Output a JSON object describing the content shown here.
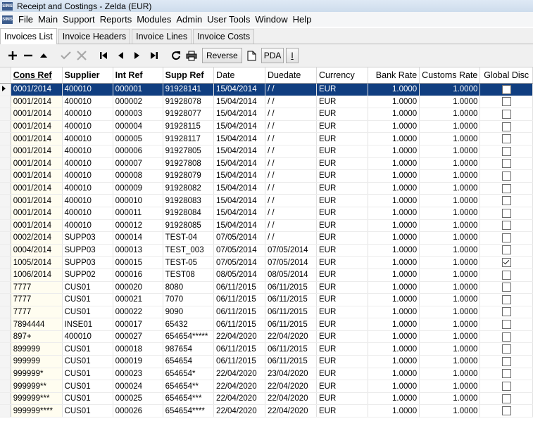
{
  "window": {
    "title": "Receipt and Costings - Zelda (EUR)",
    "app_icon_text": "SIMS"
  },
  "menu": [
    "File",
    "Main",
    "Support",
    "Reports",
    "Modules",
    "Admin",
    "User Tools",
    "Window",
    "Help"
  ],
  "tabs": [
    "Invoices List",
    "Invoice Headers",
    "Invoice Lines",
    "Invoice Costs"
  ],
  "toolbar": {
    "reverse_label": "Reverse",
    "pda_label": "PDA",
    "i_label": "I"
  },
  "columns": [
    "Cons Ref",
    "Supplier",
    "Int Ref",
    "Supp Ref",
    "Date",
    "Duedate",
    "Currency",
    "Bank Rate",
    "Customs Rate",
    "Global Disc"
  ],
  "rows": [
    [
      "0001/2014",
      "400010",
      "000001",
      "91928141",
      "15/04/2014",
      "/ /",
      "EUR",
      "1.0000",
      "1.0000",
      false
    ],
    [
      "0001/2014",
      "400010",
      "000002",
      "91928078",
      "15/04/2014",
      "/ /",
      "EUR",
      "1.0000",
      "1.0000",
      false
    ],
    [
      "0001/2014",
      "400010",
      "000003",
      "91928077",
      "15/04/2014",
      "/ /",
      "EUR",
      "1.0000",
      "1.0000",
      false
    ],
    [
      "0001/2014",
      "400010",
      "000004",
      "91928115",
      "15/04/2014",
      "/ /",
      "EUR",
      "1.0000",
      "1.0000",
      false
    ],
    [
      "0001/2014",
      "400010",
      "000005",
      "91928117",
      "15/04/2014",
      "/ /",
      "EUR",
      "1.0000",
      "1.0000",
      false
    ],
    [
      "0001/2014",
      "400010",
      "000006",
      "91927805",
      "15/04/2014",
      "/ /",
      "EUR",
      "1.0000",
      "1.0000",
      false
    ],
    [
      "0001/2014",
      "400010",
      "000007",
      "91927808",
      "15/04/2014",
      "/ /",
      "EUR",
      "1.0000",
      "1.0000",
      false
    ],
    [
      "0001/2014",
      "400010",
      "000008",
      "91928079",
      "15/04/2014",
      "/ /",
      "EUR",
      "1.0000",
      "1.0000",
      false
    ],
    [
      "0001/2014",
      "400010",
      "000009",
      "91928082",
      "15/04/2014",
      "/ /",
      "EUR",
      "1.0000",
      "1.0000",
      false
    ],
    [
      "0001/2014",
      "400010",
      "000010",
      "91928083",
      "15/04/2014",
      "/ /",
      "EUR",
      "1.0000",
      "1.0000",
      false
    ],
    [
      "0001/2014",
      "400010",
      "000011",
      "91928084",
      "15/04/2014",
      "/ /",
      "EUR",
      "1.0000",
      "1.0000",
      false
    ],
    [
      "0001/2014",
      "400010",
      "000012",
      "91928085",
      "15/04/2014",
      "/ /",
      "EUR",
      "1.0000",
      "1.0000",
      false
    ],
    [
      "0002/2014",
      "SUPP03",
      "000014",
      "TEST-04",
      "07/05/2014",
      "/ /",
      "EUR",
      "1.0000",
      "1.0000",
      false
    ],
    [
      "0004/2014",
      "SUPP03",
      "000013",
      "TEST_003",
      "07/05/2014",
      "07/05/2014",
      "EUR",
      "1.0000",
      "1.0000",
      false
    ],
    [
      "1005/2014",
      "SUPP03",
      "000015",
      "TEST-05",
      "07/05/2014",
      "07/05/2014",
      "EUR",
      "1.0000",
      "1.0000",
      true
    ],
    [
      "1006/2014",
      "SUPP02",
      "000016",
      "TEST08",
      "08/05/2014",
      "08/05/2014",
      "EUR",
      "1.0000",
      "1.0000",
      false
    ],
    [
      "7777",
      "CUS01",
      "000020",
      "8080",
      "06/11/2015",
      "06/11/2015",
      "EUR",
      "1.0000",
      "1.0000",
      false
    ],
    [
      "7777",
      "CUS01",
      "000021",
      "7070",
      "06/11/2015",
      "06/11/2015",
      "EUR",
      "1.0000",
      "1.0000",
      false
    ],
    [
      "7777",
      "CUS01",
      "000022",
      "9090",
      "06/11/2015",
      "06/11/2015",
      "EUR",
      "1.0000",
      "1.0000",
      false
    ],
    [
      "7894444",
      "INSE01",
      "000017",
      "65432",
      "06/11/2015",
      "06/11/2015",
      "EUR",
      "1.0000",
      "1.0000",
      false
    ],
    [
      "897+",
      "400010",
      "000027",
      "654654*****",
      "22/04/2020",
      "22/04/2020",
      "EUR",
      "1.0000",
      "1.0000",
      false
    ],
    [
      "899999",
      "CUS01",
      "000018",
      "987654",
      "06/11/2015",
      "06/11/2015",
      "EUR",
      "1.0000",
      "1.0000",
      false
    ],
    [
      "999999",
      "CUS01",
      "000019",
      "654654",
      "06/11/2015",
      "06/11/2015",
      "EUR",
      "1.0000",
      "1.0000",
      false
    ],
    [
      "999999*",
      "CUS01",
      "000023",
      "654654*",
      "22/04/2020",
      "23/04/2020",
      "EUR",
      "1.0000",
      "1.0000",
      false
    ],
    [
      "999999**",
      "CUS01",
      "000024",
      "654654**",
      "22/04/2020",
      "22/04/2020",
      "EUR",
      "1.0000",
      "1.0000",
      false
    ],
    [
      "999999***",
      "CUS01",
      "000025",
      "654654***",
      "22/04/2020",
      "22/04/2020",
      "EUR",
      "1.0000",
      "1.0000",
      false
    ],
    [
      "999999****",
      "CUS01",
      "000026",
      "654654****",
      "22/04/2020",
      "22/04/2020",
      "EUR",
      "1.0000",
      "1.0000",
      false
    ]
  ]
}
